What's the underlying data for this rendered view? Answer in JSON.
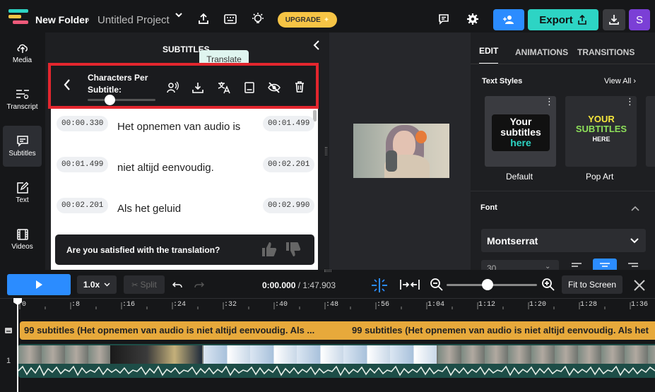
{
  "header": {
    "folder": "New Folder",
    "chevron": "›",
    "project": "Untitled Project",
    "upgrade_label": "UPGRADE",
    "export_label": "Export",
    "avatar_letter": "S",
    "colors": {
      "upgrade": "#f6c445",
      "export": "#2dd4c4",
      "invite": "#2b8cff",
      "avatar": "#7b3fd6"
    }
  },
  "sidebar": {
    "items": [
      {
        "label": "Media",
        "icon": "cloud-upload-icon"
      },
      {
        "label": "Transcript",
        "icon": "transcript-icon"
      },
      {
        "label": "Subtitles",
        "icon": "subtitles-icon",
        "active": true
      },
      {
        "label": "Text",
        "icon": "text-edit-icon"
      },
      {
        "label": "Videos",
        "icon": "film-icon"
      }
    ]
  },
  "subtitles_panel": {
    "title": "SUBTITLES",
    "toolbar_label_line1": "Characters Per",
    "toolbar_label_line2": "Subtitle:",
    "tooltip": "Translate",
    "rows": [
      {
        "start": "00:00.330",
        "text": "Het opnemen van audio is",
        "end": "00:01.499"
      },
      {
        "start": "00:01.499",
        "text": "niet altijd eenvoudig.",
        "end": "00:02.201"
      },
      {
        "start": "00:02.201",
        "text": "Als het geluid",
        "end": "00:02.990"
      }
    ],
    "feedback_question": "Are you satisfied with the translation?",
    "highlight_color": "#e3262e"
  },
  "right_panel": {
    "tabs": [
      "EDIT",
      "ANIMATIONS",
      "TRANSITIONS"
    ],
    "text_styles_label": "Text Styles",
    "view_all_label": "View All ›",
    "style_cards": [
      {
        "name": "Default",
        "preview_line1": "Your",
        "preview_line2": "subtitles",
        "preview_line3": "here"
      },
      {
        "name": "Pop Art",
        "preview_line1": "YOUR",
        "preview_line2": "SUBTITLES",
        "preview_line3": "HERE"
      }
    ],
    "font_section_label": "Font",
    "font_value": "Montserrat",
    "font_size_value": "30"
  },
  "timeline": {
    "speed_label": "1.0x",
    "split_label": "Split",
    "current_time": "0:00.000",
    "separator": " / ",
    "total_time": "1:47.903",
    "fit_label": "Fit to Screen",
    "ticks": [
      "0",
      ":8",
      ":16",
      ":24",
      ":32",
      ":40",
      ":48",
      ":56",
      "1:04",
      "1:12",
      "1:20",
      "1:28",
      "1:36"
    ],
    "subtitle_track_text": "99 subtitles (Het opnemen van audio is niet altijd eenvoudig. Als ...",
    "subtitle_track_text_2": "99 subtitles (Het opnemen van audio is niet altijd eenvoudig. Als het",
    "video_track_number": "1",
    "track_color": "#e7a93b"
  }
}
